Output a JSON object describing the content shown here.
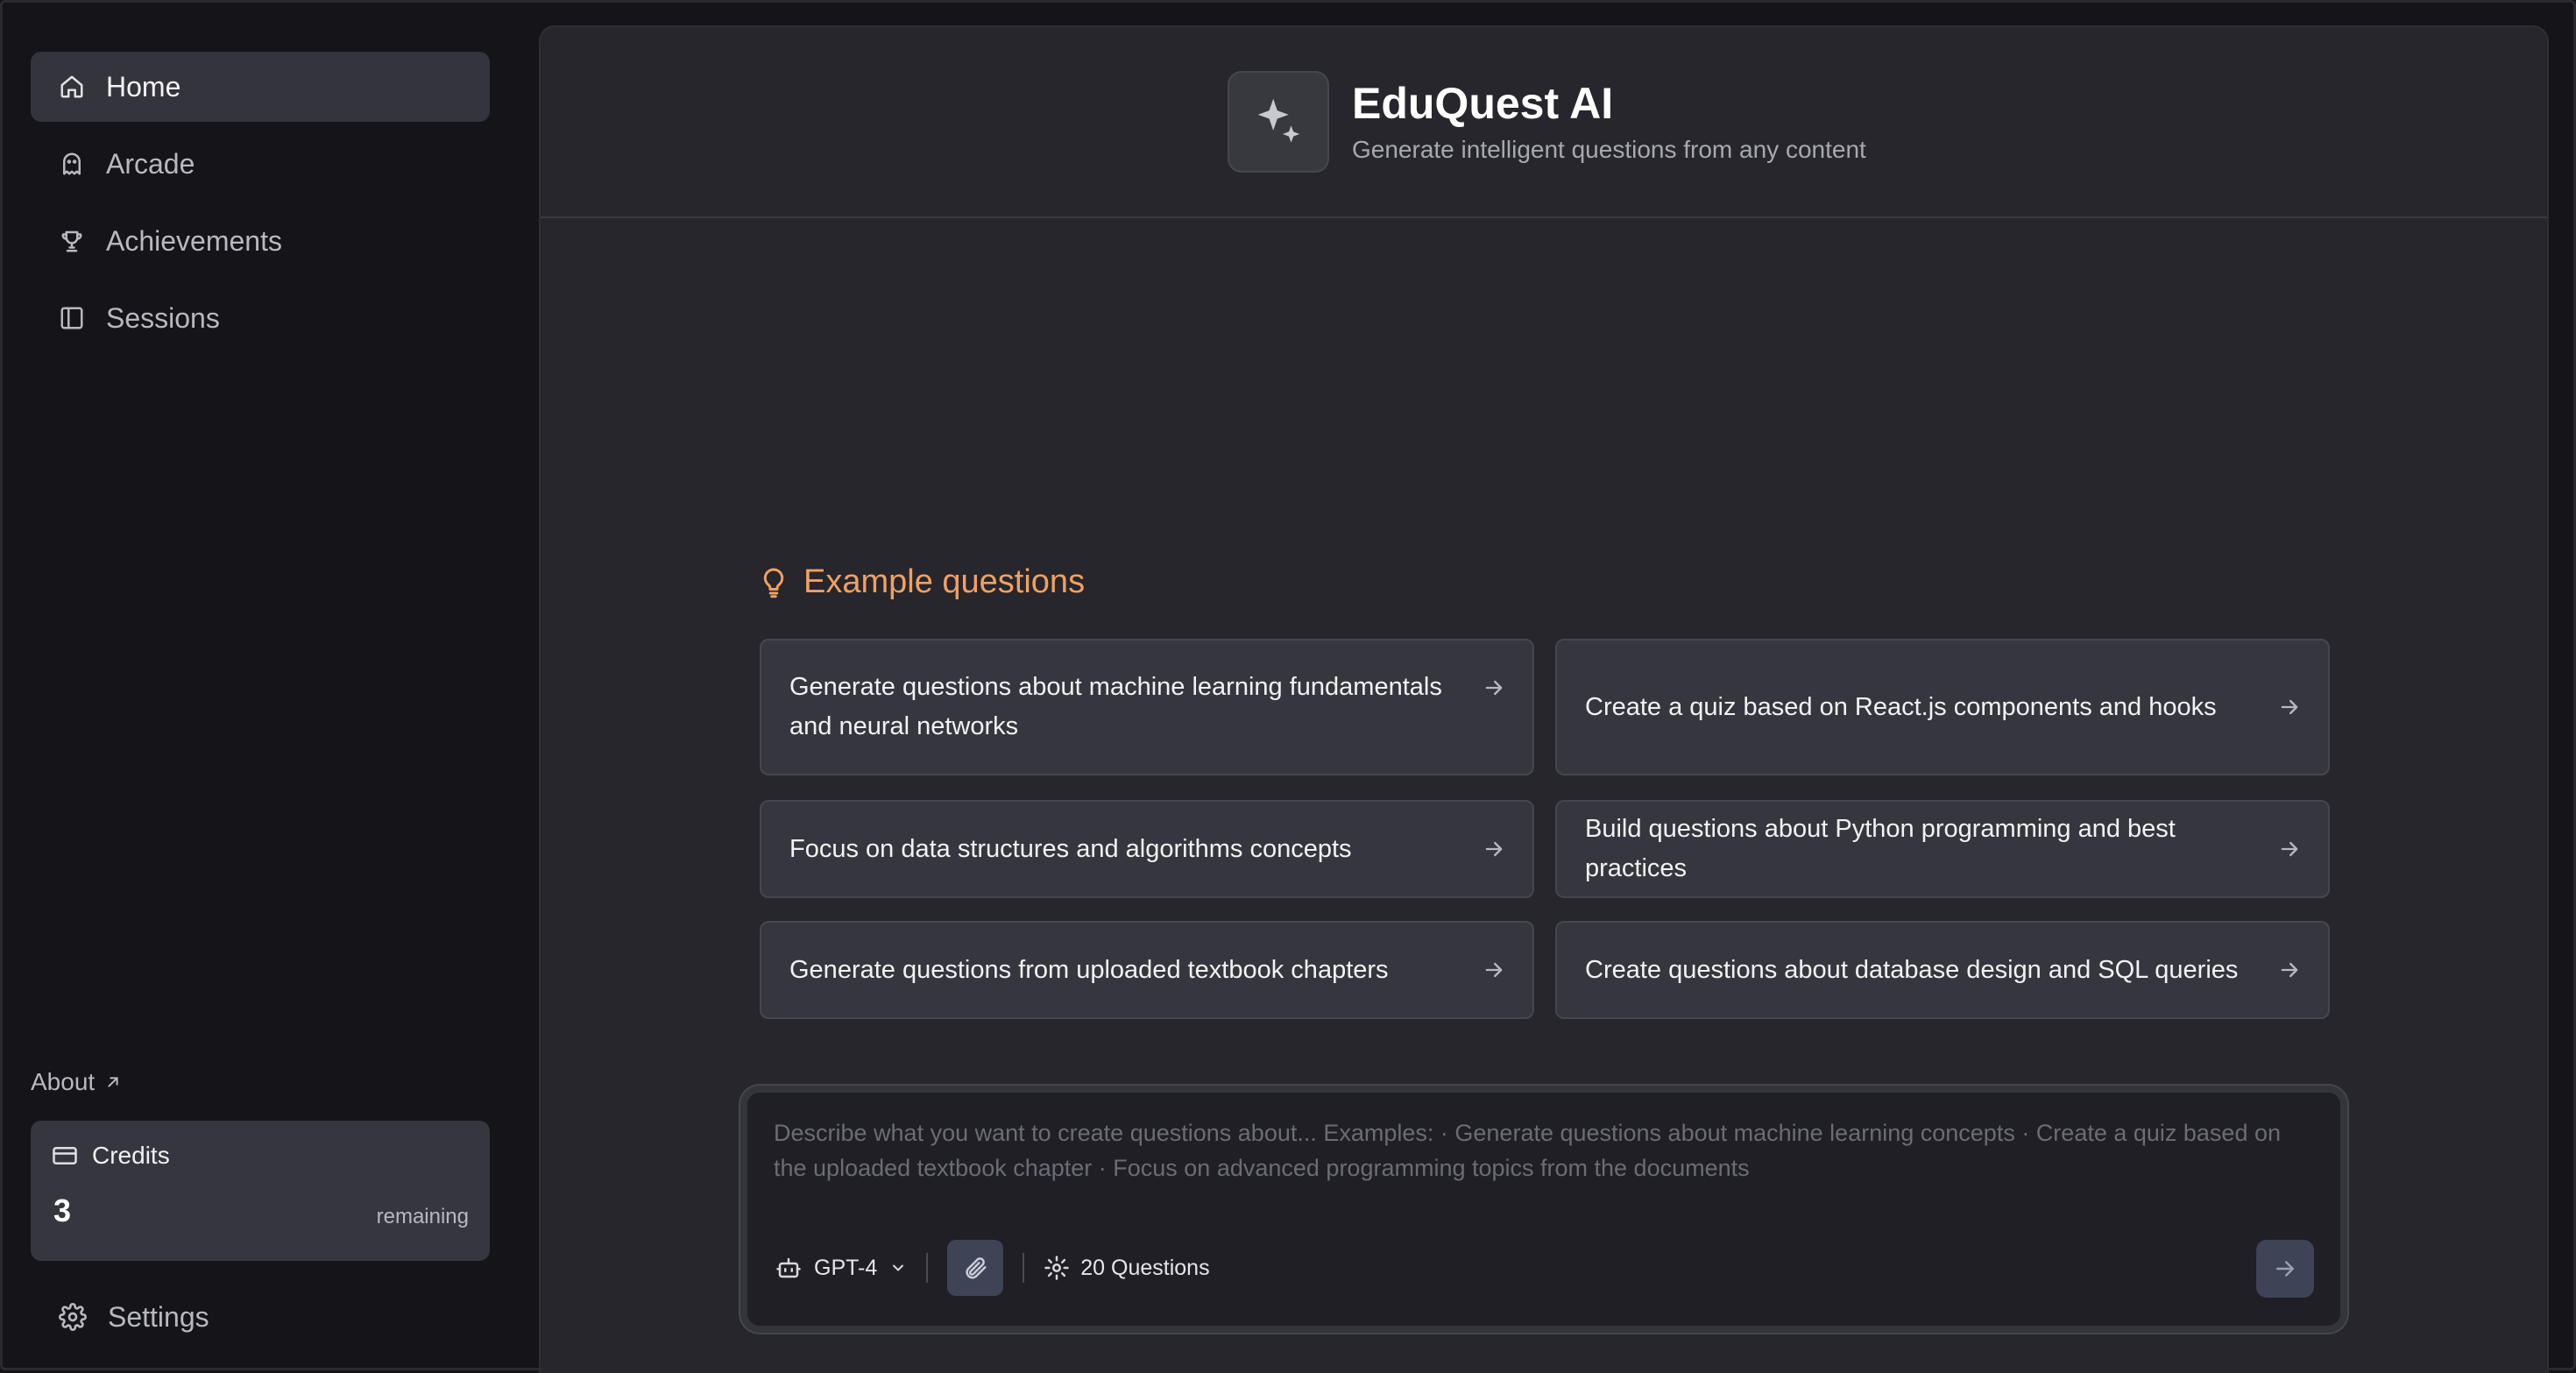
{
  "sidebar": {
    "items": [
      {
        "label": "Home",
        "icon": "home-icon",
        "active": true
      },
      {
        "label": "Arcade",
        "icon": "ghost-icon",
        "active": false
      },
      {
        "label": "Achievements",
        "icon": "trophy-icon",
        "active": false
      },
      {
        "label": "Sessions",
        "icon": "panel-icon",
        "active": false
      }
    ],
    "about_label": "About",
    "credits": {
      "label": "Credits",
      "count": "3",
      "remaining_label": "remaining"
    },
    "settings_label": "Settings"
  },
  "header": {
    "title": "EduQuest AI",
    "subtitle": "Generate intelligent questions from any content"
  },
  "examples": {
    "title": "Example questions",
    "cards": [
      "Generate questions about machine learning fundamentals and neural networks",
      "Create a quiz based on React.js components and hooks",
      "Focus on data structures and algorithms concepts",
      "Build questions about Python programming and best practices",
      "Generate questions from uploaded textbook chapters",
      "Create questions about database design and SQL queries"
    ]
  },
  "composer": {
    "placeholder": "Describe what you want to create questions about...  Examples: · Generate questions about machine learning concepts · Create a quiz based on the uploaded textbook chapter   · Focus on advanced programming topics from the documents",
    "model": "GPT-4",
    "question_count": "20 Questions"
  },
  "colors": {
    "accent": "#f0a062",
    "sidebar_bg": "#141419",
    "main_bg": "#26262c",
    "card_bg": "#36363e",
    "button_bg": "#3e4456"
  }
}
